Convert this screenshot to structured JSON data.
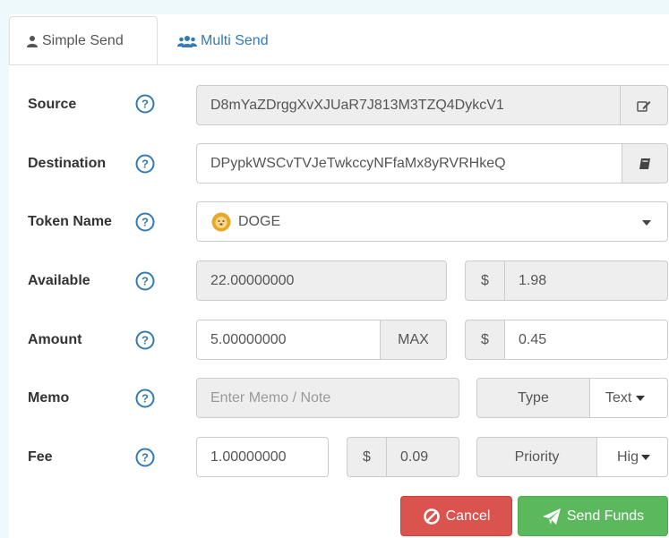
{
  "tabs": {
    "simple_send": "Simple Send",
    "multi_send": "Multi Send"
  },
  "labels": {
    "source": "Source",
    "destination": "Destination",
    "token_name": "Token Name",
    "available": "Available",
    "amount": "Amount",
    "memo": "Memo",
    "fee": "Fee"
  },
  "fields": {
    "source_address": "D8mYaZDrggXvXJUaR7J813M3TZQ4DykcV1",
    "destination_address": "DPypkWSCvTVJeTwkccyNFfaMx8yRVRHkeQ",
    "token_name": "DOGE",
    "available_amount": "22.00000000",
    "available_usd": "1.98",
    "amount": "5.00000000",
    "amount_usd": "0.45",
    "memo_placeholder": "Enter Memo / Note",
    "memo_type_label": "Type",
    "memo_type_value": "Text",
    "fee": "1.00000000",
    "fee_usd": "0.09",
    "priority_label": "Priority",
    "priority_value": "Hig"
  },
  "addons": {
    "max": "MAX",
    "currency": "$"
  },
  "buttons": {
    "cancel": "Cancel",
    "send_funds": "Send Funds"
  },
  "colors": {
    "accent_blue": "#337ab7",
    "cancel_red": "#d9534f",
    "send_green": "#5cb85c",
    "token_gold": "#e6a82a"
  },
  "icons": {
    "simple_send_tab": "user-icon",
    "multi_send_tab": "users-icon",
    "help": "question-circle-icon",
    "source_edit": "edit-icon",
    "destination_book": "address-book-icon",
    "token": "doge-coin-icon",
    "cancel": "ban-icon",
    "send": "paper-plane-icon"
  }
}
